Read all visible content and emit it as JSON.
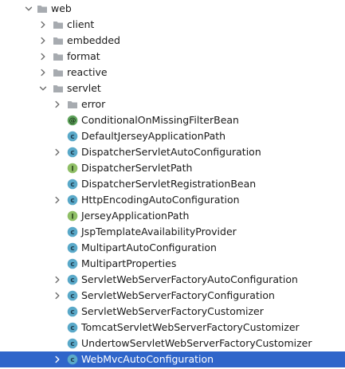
{
  "colors": {
    "selection_bg": "#2f65ca",
    "folder_gray": "#a7abb0",
    "class_icon": "#5aa9c9",
    "interface_icon": "#8fbf66",
    "annotation_icon": "#5ea35b"
  },
  "tree": {
    "items": [
      {
        "label": "web",
        "depth": 0,
        "expander": "expanded",
        "icon": "folder-icon",
        "selected": false
      },
      {
        "label": "client",
        "depth": 1,
        "expander": "collapsed",
        "icon": "folder-icon",
        "selected": false
      },
      {
        "label": "embedded",
        "depth": 1,
        "expander": "collapsed",
        "icon": "folder-icon",
        "selected": false
      },
      {
        "label": "format",
        "depth": 1,
        "expander": "collapsed",
        "icon": "folder-icon",
        "selected": false
      },
      {
        "label": "reactive",
        "depth": 1,
        "expander": "collapsed",
        "icon": "folder-icon",
        "selected": false
      },
      {
        "label": "servlet",
        "depth": 1,
        "expander": "expanded",
        "icon": "folder-icon",
        "selected": false
      },
      {
        "label": "error",
        "depth": 2,
        "expander": "collapsed",
        "icon": "folder-icon",
        "selected": false
      },
      {
        "label": "ConditionalOnMissingFilterBean",
        "depth": 2,
        "expander": "none",
        "icon": "annotation-icon",
        "selected": false
      },
      {
        "label": "DefaultJerseyApplicationPath",
        "depth": 2,
        "expander": "none",
        "icon": "class-icon",
        "selected": false
      },
      {
        "label": "DispatcherServletAutoConfiguration",
        "depth": 2,
        "expander": "collapsed",
        "icon": "class-icon",
        "selected": false
      },
      {
        "label": "DispatcherServletPath",
        "depth": 2,
        "expander": "none",
        "icon": "interface-icon",
        "selected": false
      },
      {
        "label": "DispatcherServletRegistrationBean",
        "depth": 2,
        "expander": "none",
        "icon": "class-icon",
        "selected": false
      },
      {
        "label": "HttpEncodingAutoConfiguration",
        "depth": 2,
        "expander": "collapsed",
        "icon": "class-icon",
        "selected": false
      },
      {
        "label": "JerseyApplicationPath",
        "depth": 2,
        "expander": "none",
        "icon": "interface-icon",
        "selected": false
      },
      {
        "label": "JspTemplateAvailabilityProvider",
        "depth": 2,
        "expander": "none",
        "icon": "class-icon",
        "selected": false
      },
      {
        "label": "MultipartAutoConfiguration",
        "depth": 2,
        "expander": "none",
        "icon": "class-icon",
        "selected": false
      },
      {
        "label": "MultipartProperties",
        "depth": 2,
        "expander": "none",
        "icon": "class-icon",
        "selected": false
      },
      {
        "label": "ServletWebServerFactoryAutoConfiguration",
        "depth": 2,
        "expander": "collapsed",
        "icon": "class-icon",
        "selected": false
      },
      {
        "label": "ServletWebServerFactoryConfiguration",
        "depth": 2,
        "expander": "collapsed",
        "icon": "class-icon",
        "selected": false
      },
      {
        "label": "ServletWebServerFactoryCustomizer",
        "depth": 2,
        "expander": "none",
        "icon": "class-icon",
        "selected": false
      },
      {
        "label": "TomcatServletWebServerFactoryCustomizer",
        "depth": 2,
        "expander": "none",
        "icon": "class-icon",
        "selected": false
      },
      {
        "label": "UndertowServletWebServerFactoryCustomizer",
        "depth": 2,
        "expander": "none",
        "icon": "class-icon",
        "selected": false
      },
      {
        "label": "WebMvcAutoConfiguration",
        "depth": 2,
        "expander": "collapsed",
        "icon": "class-icon",
        "selected": true
      }
    ]
  }
}
